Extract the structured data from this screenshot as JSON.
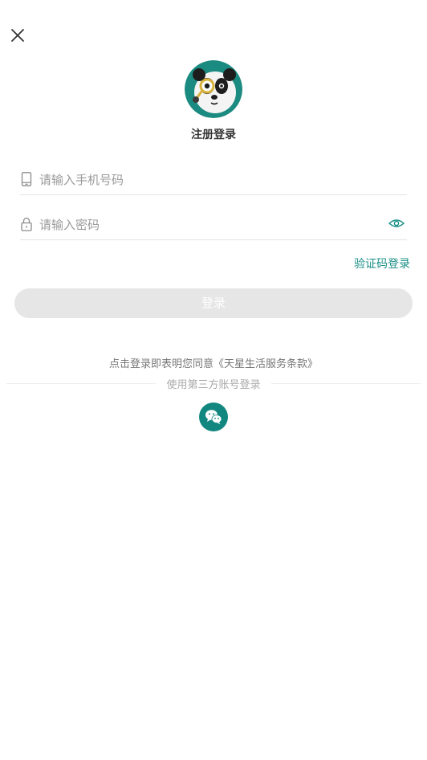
{
  "header": {
    "close_icon": "close-icon"
  },
  "profile": {
    "title": "注册登录",
    "avatar_icon": "panda-detective-avatar"
  },
  "form": {
    "phone": {
      "icon": "phone-icon",
      "placeholder": "请输入手机号码",
      "value": ""
    },
    "password": {
      "icon": "lock-icon",
      "placeholder": "请输入密码",
      "value": "",
      "toggle_icon": "eye-icon"
    },
    "sms_login_label": "验证码登录",
    "submit_label": "登录"
  },
  "agreement": {
    "prefix": "点击登录即表明您同意",
    "terms": "《天星生活服务条款》"
  },
  "third_party": {
    "label": "使用第三方账号登录",
    "wechat_icon": "wechat-icon"
  },
  "colors": {
    "accent": "#1a8f86",
    "wechat_bg": "#11877f",
    "button_disabled": "#e6e6e6"
  }
}
